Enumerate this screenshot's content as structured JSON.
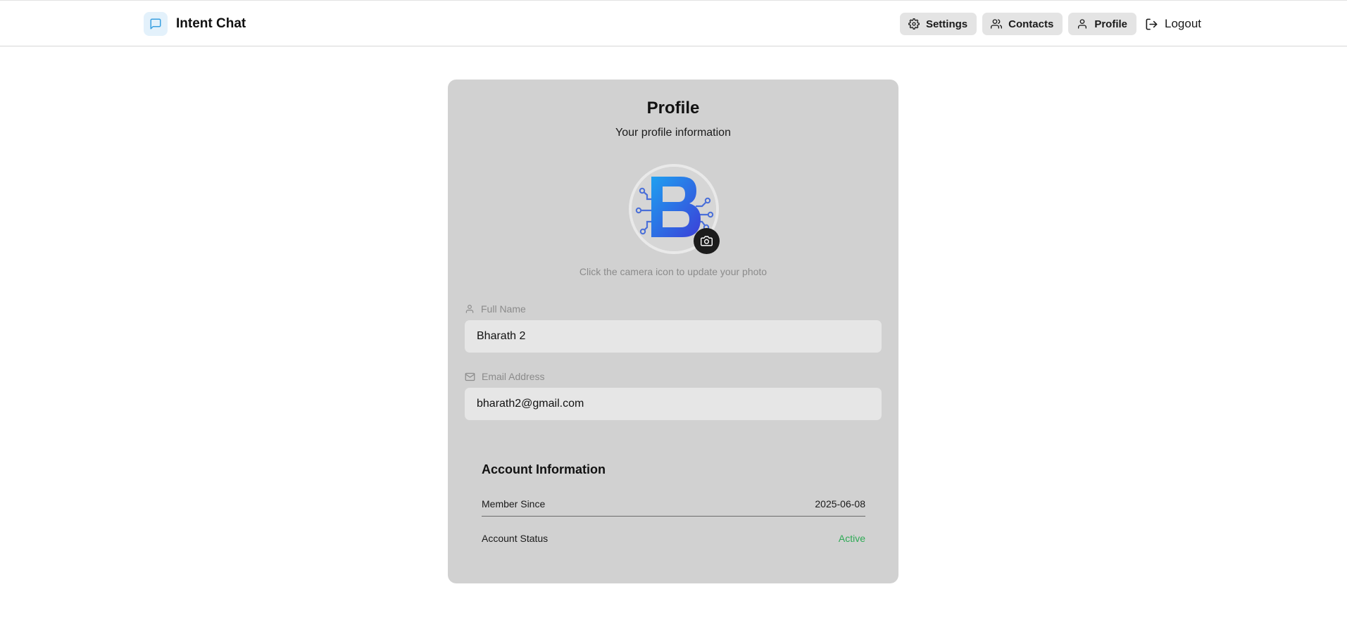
{
  "header": {
    "app_title": "Intent Chat",
    "brand_icon": "chat-bubble-icon",
    "nav": [
      {
        "label": "Settings",
        "icon": "gear-icon"
      },
      {
        "label": "Contacts",
        "icon": "users-icon"
      },
      {
        "label": "Profile",
        "icon": "user-icon"
      }
    ],
    "logout_label": "Logout",
    "logout_icon": "logout-icon"
  },
  "profile": {
    "title": "Profile",
    "subtitle": "Your profile information",
    "avatar_icon": "avatar-image",
    "camera_icon": "camera-icon",
    "photo_hint": "Click the camera icon to update your photo",
    "full_name_label": "Full Name",
    "full_name_value": "Bharath 2",
    "email_label": "Email Address",
    "email_value": "bharath2@gmail.com"
  },
  "account": {
    "title": "Account Information",
    "member_since_label": "Member Since",
    "member_since_value": "2025-06-08",
    "status_label": "Account Status",
    "status_value": "Active"
  },
  "colors": {
    "card_bg": "#d1d1d1",
    "input_bg": "#e6e6e6",
    "nav_btn_bg": "#e4e4e4",
    "active_status": "#2eaa55",
    "brand_icon_bg": "#e3f1fb",
    "brand_icon_stroke": "#3aa0e0"
  }
}
